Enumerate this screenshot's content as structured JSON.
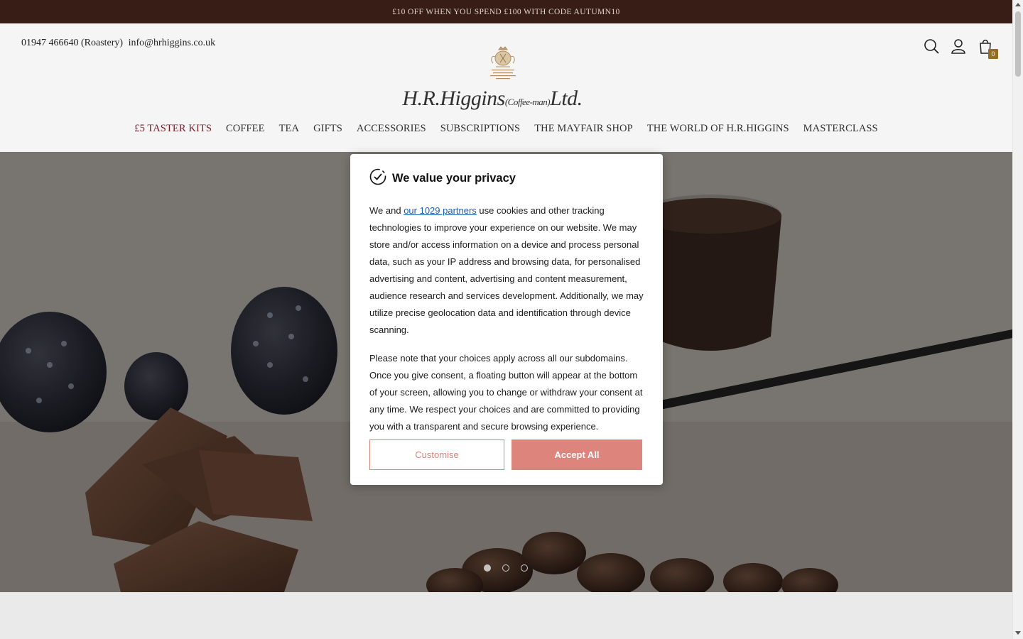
{
  "announcement": {
    "text": "£10 OFF WHEN YOU SPEND £100 WITH CODE AUTUMN10"
  },
  "header": {
    "phone": "01947 466640 (Roastery)",
    "email": "info@hrhiggins.co.uk",
    "logo_text": "H.R.Higgins",
    "logo_sub": "(Coffee-man)",
    "logo_suffix": "Ltd.",
    "cart_count": "0",
    "icons": [
      "search-icon",
      "user-icon",
      "shopping-bag-icon"
    ]
  },
  "nav": {
    "items": [
      {
        "label": "£5 TASTER KITS"
      },
      {
        "label": "COFFEE"
      },
      {
        "label": "TEA"
      },
      {
        "label": "GIFTS"
      },
      {
        "label": "ACCESSORIES"
      },
      {
        "label": "SUBSCRIPTIONS"
      },
      {
        "label": "THE MAYFAIR SHOP"
      },
      {
        "label": "THE WORLD OF H.R.HIGGINS"
      },
      {
        "label": "MASTERCLASS"
      }
    ]
  },
  "hero": {
    "slide_count": 3,
    "active_slide": 1
  },
  "consent": {
    "title": "We value your privacy",
    "p1_before": "We and ",
    "p1_link": "our 1029 partners",
    "p1_after": " use cookies and other tracking technologies to improve your experience on our website. We may store and/or access information on a device and process personal data, such as your IP address and browsing data, for personalised advertising and content, advertising and content measurement, audience research and services development. Additionally, we may utilize precise geolocation data and identification through device scanning.",
    "p2": "Please note that your choices apply across all our subdomains. Once you give consent, a floating button will appear at the bottom of your screen, allowing you to change or withdraw your consent at any time. We respect your choices and are committed to providing you with a transparent and secure browsing experience.",
    "customise_label": "Customise",
    "accept_label": "Accept All"
  },
  "colors": {
    "announcement_bg": "#3a1f16",
    "highlight_nav": "#7a1f2b",
    "accent": "#dd857d",
    "cart_badge": "#9a7326"
  }
}
